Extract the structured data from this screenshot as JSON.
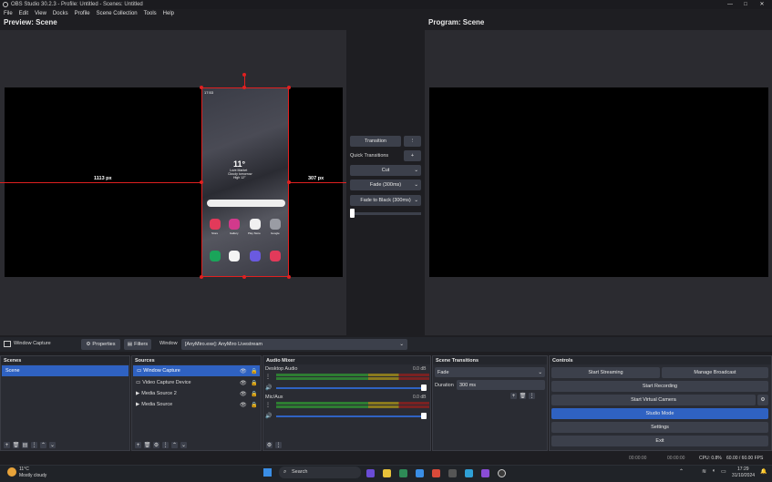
{
  "window": {
    "title": "OBS Studio 30.2.3 - Profile: Untitled - Scenes: Untitled",
    "min": "—",
    "max": "□",
    "close": "✕"
  },
  "menu": [
    "File",
    "Edit",
    "View",
    "Docks",
    "Profile",
    "Scene Collection",
    "Tools",
    "Help"
  ],
  "preview": {
    "title": "Preview: Scene",
    "left_measure": "1113 px",
    "right_measure": "307 px"
  },
  "program": {
    "title": "Program: Scene"
  },
  "phone": {
    "time": "17:53",
    "weather_temp": "11°",
    "weather_line1": "Lovе Market",
    "weather_line2": "Cloudy tomorrow",
    "weather_line3": "High 12°",
    "apps_row1": [
      "Store",
      "Gallery",
      "Play Store",
      "Google"
    ]
  },
  "transitions_panel": {
    "transition_btn": "Transition",
    "quick_label": "Quick Transitions",
    "cut": "Cut",
    "fade": "Fade (300ms)",
    "fade_black": "Fade to Black (300ms)"
  },
  "source_toolbar": {
    "source_name": "Window Capture",
    "properties": "Properties",
    "filters": "Filters",
    "window_label": "Window",
    "window_value": "[AnyMiro.exe]: AnyMiro Livestream"
  },
  "scenes": {
    "title": "Scenes",
    "items": [
      "Scene"
    ]
  },
  "sources": {
    "title": "Sources",
    "items": [
      "Window Capture",
      "Video Capture Device",
      "Media Source 2",
      "Media Source"
    ]
  },
  "mixer": {
    "title": "Audio Mixer",
    "channels": [
      {
        "name": "Desktop Audio",
        "db": "0.0 dB"
      },
      {
        "name": "Mic/Aux",
        "db": "0.0 dB"
      }
    ],
    "scale": [
      "-60",
      "-55",
      "-50",
      "-45",
      "-40",
      "-35",
      "-30",
      "-25",
      "-20",
      "-15",
      "-10",
      "-5",
      "0"
    ]
  },
  "scene_transitions": {
    "title": "Scene Transitions",
    "selected": "Fade",
    "duration_label": "Duration",
    "duration_value": "300 ms"
  },
  "controls": {
    "title": "Controls",
    "start_streaming": "Start Streaming",
    "manage_broadcast": "Manage Broadcast",
    "start_recording": "Start Recording",
    "start_virtual_camera": "Start Virtual Camera",
    "studio_mode": "Studio Mode",
    "settings": "Settings",
    "exit": "Exit"
  },
  "statusbar": {
    "stream_time": "00:00:00",
    "rec_time": "00:00:00",
    "cpu": "CPU: 0.8%",
    "fps": "60.00 / 60.00 FPS"
  },
  "taskbar": {
    "weather_temp": "11°C",
    "weather_desc": "Mostly cloudy",
    "search": "Search",
    "time": "17:29",
    "date": "31/10/2024"
  },
  "colors": {
    "accent": "#2f62c2",
    "selection_red": "#e02020"
  }
}
